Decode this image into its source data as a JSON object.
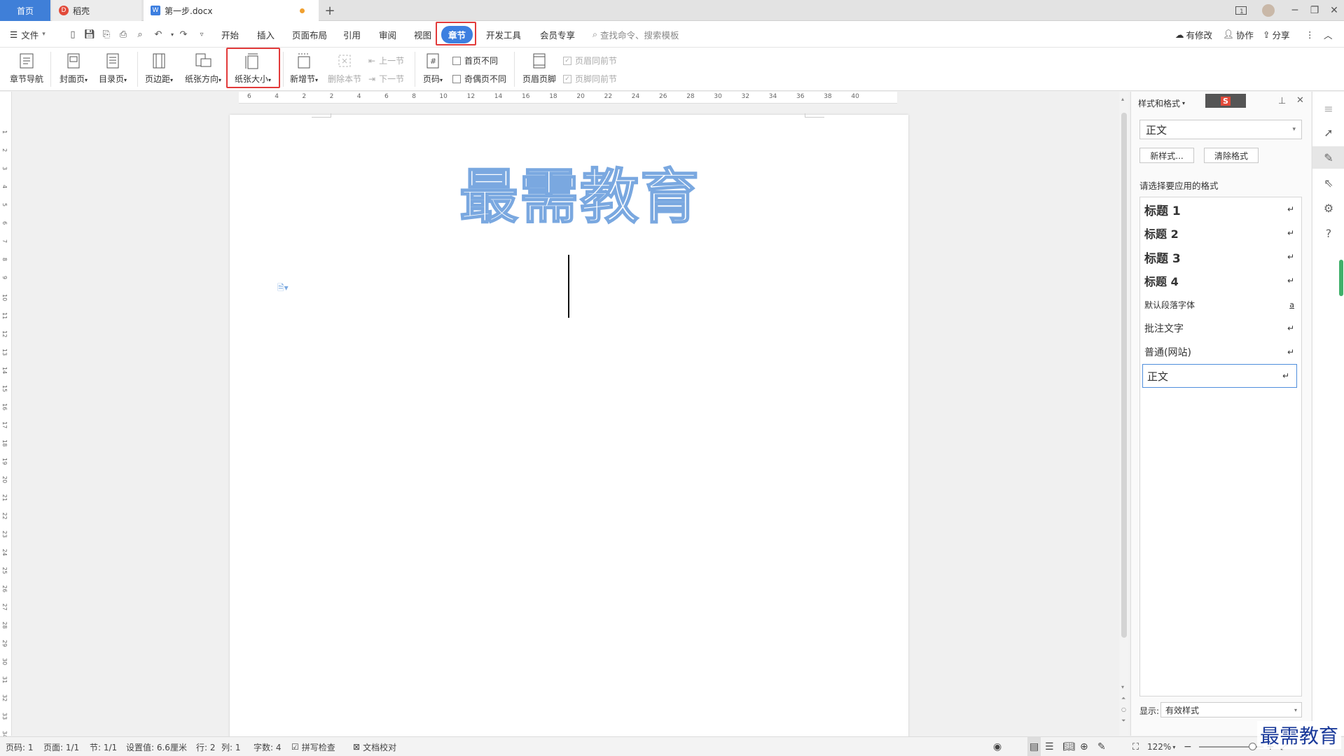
{
  "tabs": {
    "home": "首页",
    "daoke": "稻壳",
    "doc": "第一步.docx"
  },
  "menu": {
    "file": "文件",
    "items": [
      "开始",
      "插入",
      "页面布局",
      "引用",
      "审阅",
      "视图",
      "章节",
      "开发工具",
      "会员专享"
    ],
    "search_placeholder": "查找命令、搜索模板",
    "right": {
      "modify": "有修改",
      "collab": "协作",
      "share": "分享"
    }
  },
  "ribbon": {
    "chapter_nav": "章节导航",
    "cover": "封面页",
    "toc": "目录页",
    "margin": "页边距",
    "orientation": "纸张方向",
    "paper_size": "纸张大小",
    "new_section": "新增节",
    "delete_section": "删除本节",
    "prev_section": "上一节",
    "next_section": "下一节",
    "page_number": "页码",
    "first_page_diff": "首页不同",
    "odd_even_diff": "奇偶页不同",
    "header_footer": "页眉页脚",
    "header_same": "页眉同前节",
    "footer_same": "页脚同前节"
  },
  "ruler_h": [
    "6",
    "4",
    "2",
    "2",
    "4",
    "6",
    "8",
    "10",
    "12",
    "14",
    "16",
    "18",
    "20",
    "22",
    "24",
    "26",
    "28",
    "30",
    "32",
    "34",
    "36",
    "38",
    "40"
  ],
  "ruler_v": [
    "1",
    "2",
    "3",
    "4",
    "5",
    "6",
    "7",
    "8",
    "9",
    "10",
    "11",
    "12",
    "13",
    "14",
    "15",
    "16",
    "17",
    "18",
    "19",
    "20",
    "21",
    "22",
    "23",
    "24",
    "25",
    "26",
    "27",
    "28",
    "29",
    "30",
    "31",
    "32",
    "33",
    "34"
  ],
  "document": {
    "title": "最需教育"
  },
  "panel": {
    "title": "样式和格式",
    "current_style": "正文",
    "new_style": "新样式...",
    "clear_format": "清除格式",
    "choose_label": "请选择要应用的格式",
    "styles": [
      {
        "name": "标题  1",
        "mark": "↵"
      },
      {
        "name": "标题  2",
        "mark": "↵"
      },
      {
        "name": "标题  3",
        "mark": "↵"
      },
      {
        "name": "标题  4",
        "mark": "↵"
      },
      {
        "name": "默认段落字体",
        "mark": "a"
      },
      {
        "name": "批注文字",
        "mark": "↵"
      },
      {
        "name": "普通(网站)",
        "mark": "↵"
      },
      {
        "name": "正文",
        "mark": "↵"
      }
    ],
    "show_label": "显示:",
    "show_value": "有效样式"
  },
  "status": {
    "page_code": "页码: 1",
    "pages": "页面: 1/1",
    "section": "节: 1/1",
    "setting": "设置值: 6.6厘米",
    "row": "行: 2",
    "col": "列: 1",
    "chars": "字数: 4",
    "spell": "拼写检查",
    "proof": "文档校对",
    "zoom": "122%"
  },
  "watermark": "最需教育"
}
